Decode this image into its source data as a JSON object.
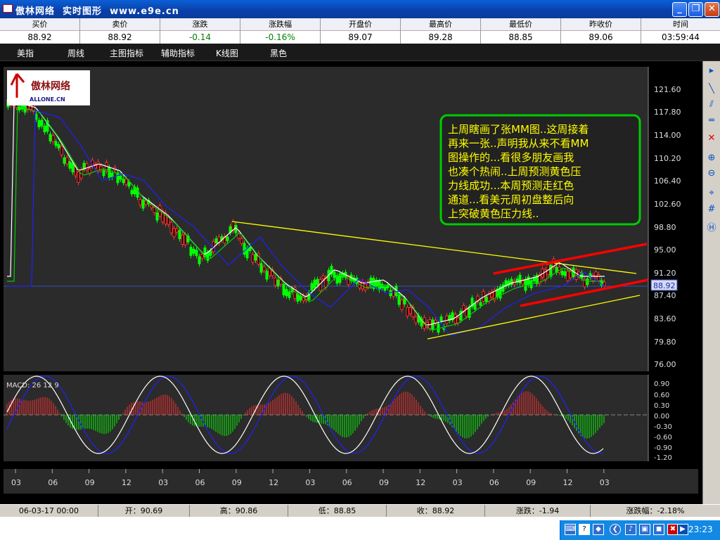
{
  "window": {
    "title": "傲林网络  实时图形  www.e9e.cn",
    "minimize": "_",
    "maximize": "❐",
    "close": "✕"
  },
  "quote": {
    "headers": [
      "买价",
      "卖价",
      "涨跌",
      "涨跌幅",
      "开盘价",
      "最高价",
      "最低价",
      "昨收价",
      "时间"
    ],
    "values": [
      "88.92",
      "88.92",
      "-0.14",
      "-0.16%",
      "89.07",
      "89.28",
      "88.85",
      "89.06",
      "03:59:44"
    ]
  },
  "menu": [
    "美指",
    "周线",
    "主图指标",
    "辅助指标",
    "K线图",
    "黑色"
  ],
  "logo": {
    "text": "傲林网络",
    "sub": "ALLONE.CN"
  },
  "annotation": {
    "lines": [
      "上周瞎画了张MM图..这周接着",
      "再来一张..声明我从来不看MM",
      "图操作的...看很多朋友画我",
      "也凑个热闹..上周预测黄色压",
      "力线成功...本周预测走红色",
      "通道...看美元周初盘整后向",
      "上突破黄色压力线.."
    ]
  },
  "price_axis": [
    "121.60",
    "117.80",
    "114.00",
    "110.20",
    "106.40",
    "102.60",
    "98.80",
    "95.00",
    "91.20",
    "87.40",
    "83.60",
    "79.80",
    "76.00"
  ],
  "last_price": "88.92",
  "macd": {
    "label": "MACD: 26 12 9",
    "axis": [
      "0.90",
      "0.60",
      "0.30",
      "0.00",
      "-0.30",
      "-0.60",
      "-0.90",
      "-1.20"
    ]
  },
  "time_axis": [
    "03",
    "06",
    "09",
    "12",
    "03",
    "06",
    "09",
    "12",
    "03",
    "06",
    "09",
    "12",
    "03",
    "06",
    "09",
    "12",
    "03"
  ],
  "status": {
    "date": "06-03-17 00:00",
    "open": "开：90.69",
    "high": "高：90.86",
    "low": "低：88.85",
    "close": "收：88.92",
    "change": "涨跌：-1.94",
    "pct": "涨跌幅：-2.18%"
  },
  "taskbar": {
    "clock": "23:23"
  },
  "colors": {
    "up": "#ff3030",
    "down": "#00ff00",
    "ma_white": "#ffffff",
    "ma_green": "#00cc00",
    "ma_blue": "#2020ff",
    "trend_yellow": "#ffff00",
    "channel_red": "#ff0000",
    "annotation_border": "#00cc00",
    "annotation_text": "#ffff00"
  }
}
